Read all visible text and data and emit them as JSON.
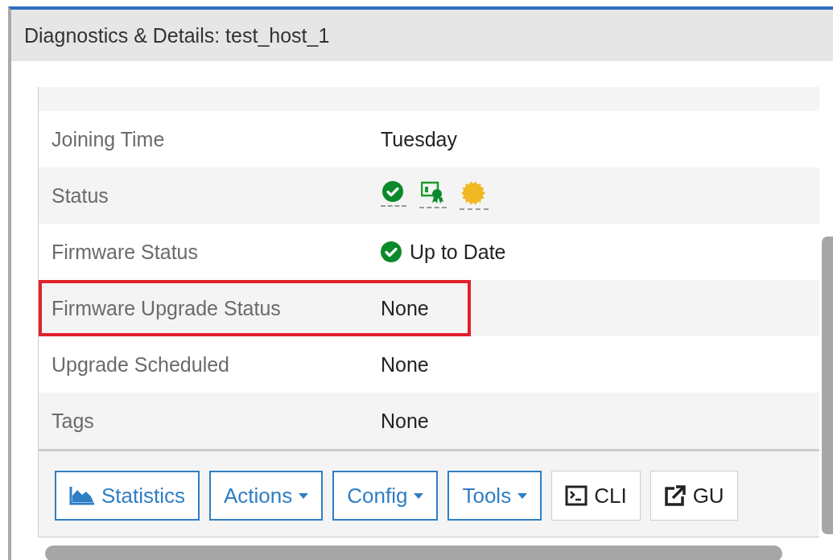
{
  "window": {
    "title": "Diagnostics & Details: test_host_1"
  },
  "rows": [
    {
      "label": "Joining Time",
      "kind": "text",
      "value": "Tuesday",
      "highlighted": false
    },
    {
      "label": "Status",
      "kind": "status-icons",
      "highlighted": false
    },
    {
      "label": "Firmware Status",
      "kind": "icon-text",
      "value": "Up to Date",
      "highlighted": false
    },
    {
      "label": "Firmware Upgrade Status",
      "kind": "text",
      "value": "None",
      "highlighted": true
    },
    {
      "label": "Upgrade Scheduled",
      "kind": "text",
      "value": "None",
      "highlighted": false
    },
    {
      "label": "Tags",
      "kind": "text",
      "value": "None",
      "highlighted": false
    }
  ],
  "toolbar": [
    {
      "label": "Statistics",
      "kind": "chart"
    },
    {
      "label": "Actions",
      "kind": "dropdown"
    },
    {
      "label": "Config",
      "kind": "dropdown"
    },
    {
      "label": "Tools",
      "kind": "dropdown"
    },
    {
      "label": "CLI",
      "kind": "terminal"
    },
    {
      "label": "GU",
      "kind": "external"
    }
  ]
}
